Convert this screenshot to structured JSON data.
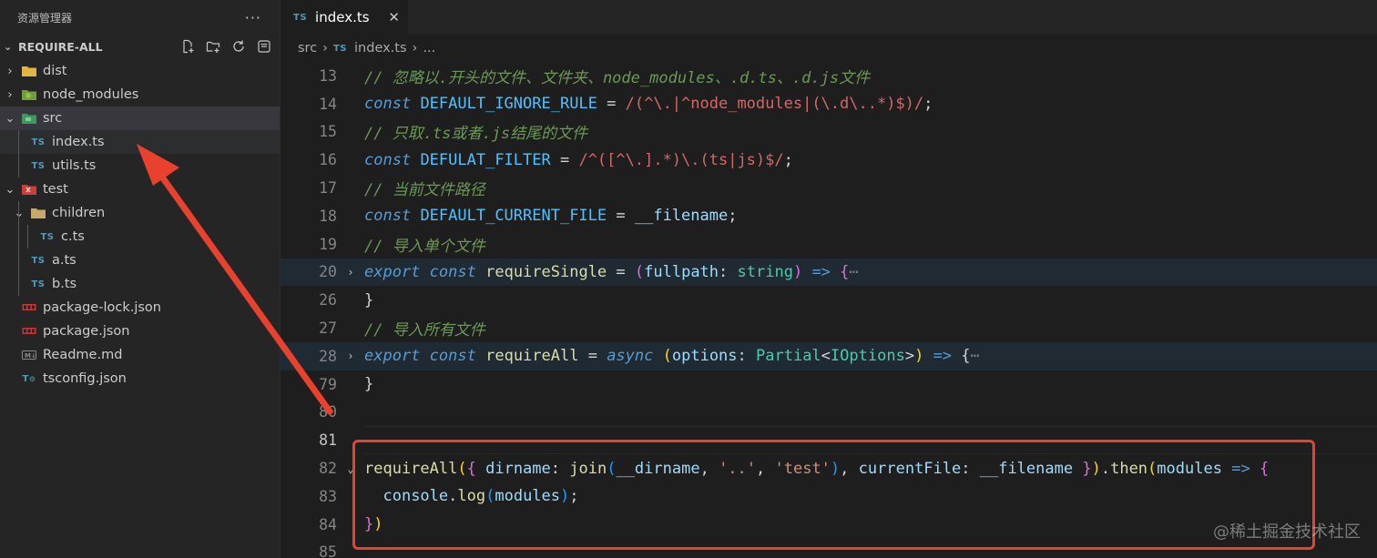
{
  "explorer": {
    "title": "资源管理器",
    "more": "···",
    "section": "REQUIRE-ALL",
    "actions": [
      "new-file-icon",
      "new-folder-icon",
      "refresh-icon",
      "collapse-all-icon"
    ]
  },
  "tree": [
    {
      "label": "dist",
      "kind": "folder",
      "depth": 0,
      "expanded": false,
      "icon": "folder-dist-icon"
    },
    {
      "label": "node_modules",
      "kind": "folder",
      "depth": 0,
      "expanded": false,
      "icon": "folder-node-icon"
    },
    {
      "label": "src",
      "kind": "folder",
      "depth": 0,
      "expanded": true,
      "icon": "folder-src-icon"
    },
    {
      "label": "index.ts",
      "kind": "ts",
      "depth": 1,
      "selected": true
    },
    {
      "label": "utils.ts",
      "kind": "ts",
      "depth": 1
    },
    {
      "label": "test",
      "kind": "folder",
      "depth": 0,
      "expanded": true,
      "icon": "folder-test-icon"
    },
    {
      "label": "children",
      "kind": "folder",
      "depth": 1,
      "expanded": true,
      "icon": "folder-open-icon"
    },
    {
      "label": "c.ts",
      "kind": "ts",
      "depth": 2
    },
    {
      "label": "a.ts",
      "kind": "ts",
      "depth": 1
    },
    {
      "label": "b.ts",
      "kind": "ts",
      "depth": 1
    },
    {
      "label": "package-lock.json",
      "kind": "npm",
      "depth": 0
    },
    {
      "label": "package.json",
      "kind": "npm",
      "depth": 0
    },
    {
      "label": "Readme.md",
      "kind": "md",
      "depth": 0
    },
    {
      "label": "tsconfig.json",
      "kind": "tsconfig",
      "depth": 0
    }
  ],
  "tab": {
    "badge": "TS",
    "label": "index.ts",
    "close": "✕"
  },
  "breadcrumb": {
    "folder": "src",
    "badge": "TS",
    "file": "index.ts",
    "more": "..."
  },
  "code": [
    {
      "n": "13",
      "segs": [
        [
          "c",
          "// 忽略以.开头的文件、文件夹、node_modules、.d.ts、.d.js文件"
        ]
      ]
    },
    {
      "n": "14",
      "segs": [
        [
          "k",
          "const"
        ],
        [
          "txt",
          " "
        ],
        [
          "v",
          "DEFAULT_IGNORE_RULE"
        ],
        [
          "txt",
          " = "
        ],
        [
          "r",
          "/(^\\.|^node_modules|(\\.d\\..*)$)/"
        ],
        [
          "txt",
          ";"
        ]
      ]
    },
    {
      "n": "15",
      "segs": [
        [
          "c",
          "// 只取.ts或者.js结尾的文件"
        ]
      ]
    },
    {
      "n": "16",
      "segs": [
        [
          "k",
          "const"
        ],
        [
          "txt",
          " "
        ],
        [
          "v",
          "DEFULAT_FILTER"
        ],
        [
          "txt",
          " = "
        ],
        [
          "r",
          "/^([^\\.].*)\\.(ts|js)$/"
        ],
        [
          "txt",
          ";"
        ]
      ]
    },
    {
      "n": "17",
      "segs": [
        [
          "c",
          "// 当前文件路径"
        ]
      ]
    },
    {
      "n": "18",
      "segs": [
        [
          "k",
          "const"
        ],
        [
          "txt",
          " "
        ],
        [
          "v",
          "DEFAULT_CURRENT_FILE"
        ],
        [
          "txt",
          " = "
        ],
        [
          "p",
          "__filename"
        ],
        [
          "txt",
          ";"
        ]
      ]
    },
    {
      "n": "19",
      "segs": [
        [
          "c",
          "// 导入单个文件"
        ]
      ]
    },
    {
      "n": "20",
      "fold": "›",
      "hl": true,
      "segs": [
        [
          "k",
          "export"
        ],
        [
          "txt",
          " "
        ],
        [
          "k",
          "const"
        ],
        [
          "txt",
          " "
        ],
        [
          "f",
          "requireSingle"
        ],
        [
          "txt",
          " = "
        ],
        [
          "b2",
          "("
        ],
        [
          "p",
          "fullpath"
        ],
        [
          "txt",
          ": "
        ],
        [
          "t",
          "string"
        ],
        [
          "b2",
          ")"
        ],
        [
          "txt",
          " "
        ],
        [
          "k",
          "=>"
        ],
        [
          "txt",
          " "
        ],
        [
          "b2",
          "{"
        ],
        [
          "ell",
          "⋯"
        ]
      ]
    },
    {
      "n": "26",
      "segs": [
        [
          "txt",
          "}"
        ]
      ]
    },
    {
      "n": "27",
      "segs": [
        [
          "c",
          "// 导入所有文件"
        ]
      ]
    },
    {
      "n": "28",
      "fold": "›",
      "hl": true,
      "segs": [
        [
          "k",
          "export"
        ],
        [
          "txt",
          " "
        ],
        [
          "k",
          "const"
        ],
        [
          "txt",
          " "
        ],
        [
          "f",
          "requireAll"
        ],
        [
          "txt",
          " = "
        ],
        [
          "k",
          "async"
        ],
        [
          "txt",
          " "
        ],
        [
          "b1",
          "("
        ],
        [
          "p",
          "options"
        ],
        [
          "txt",
          ": "
        ],
        [
          "t",
          "Partial"
        ],
        [
          "txt",
          "<"
        ],
        [
          "t",
          "IOptions"
        ],
        [
          "txt",
          ">"
        ],
        [
          "b1",
          ")"
        ],
        [
          "txt",
          " "
        ],
        [
          "k",
          "=>"
        ],
        [
          "txt",
          " "
        ],
        [
          "txt",
          "{"
        ],
        [
          "ell",
          "⋯"
        ]
      ]
    },
    {
      "n": "79",
      "segs": [
        [
          "txt",
          "}"
        ]
      ]
    },
    {
      "n": "80",
      "segs": []
    },
    {
      "n": "81",
      "cur": true,
      "segs": []
    },
    {
      "n": "82",
      "fold": "⌄",
      "segs": [
        [
          "f",
          "requireAll"
        ],
        [
          "b1",
          "("
        ],
        [
          "b2",
          "{"
        ],
        [
          "txt",
          " "
        ],
        [
          "p",
          "dirname"
        ],
        [
          "txt",
          ": "
        ],
        [
          "f",
          "join"
        ],
        [
          "b3",
          "("
        ],
        [
          "p",
          "__dirname"
        ],
        [
          "txt",
          ", "
        ],
        [
          "s",
          "'..'"
        ],
        [
          "txt",
          ", "
        ],
        [
          "s",
          "'test'"
        ],
        [
          "b3",
          ")"
        ],
        [
          "txt",
          ", "
        ],
        [
          "p",
          "currentFile"
        ],
        [
          "txt",
          ": "
        ],
        [
          "p",
          "__filename"
        ],
        [
          "txt",
          " "
        ],
        [
          "b2",
          "}"
        ],
        [
          "b1",
          ")"
        ],
        [
          "txt",
          "."
        ],
        [
          "f",
          "then"
        ],
        [
          "b1",
          "("
        ],
        [
          "p",
          "modules"
        ],
        [
          "txt",
          " "
        ],
        [
          "k",
          "=>"
        ],
        [
          "txt",
          " "
        ],
        [
          "b2",
          "{"
        ]
      ]
    },
    {
      "n": "83",
      "segs": [
        [
          "txt",
          "  "
        ],
        [
          "p",
          "console"
        ],
        [
          "txt",
          "."
        ],
        [
          "f",
          "log"
        ],
        [
          "b3",
          "("
        ],
        [
          "p",
          "modules"
        ],
        [
          "b3",
          ")"
        ],
        [
          "txt",
          ";"
        ]
      ]
    },
    {
      "n": "84",
      "segs": [
        [
          "b2",
          "}"
        ],
        [
          "b1",
          ")"
        ]
      ]
    },
    {
      "n": "85",
      "segs": []
    }
  ],
  "watermark": "@稀土掘金技术社区"
}
